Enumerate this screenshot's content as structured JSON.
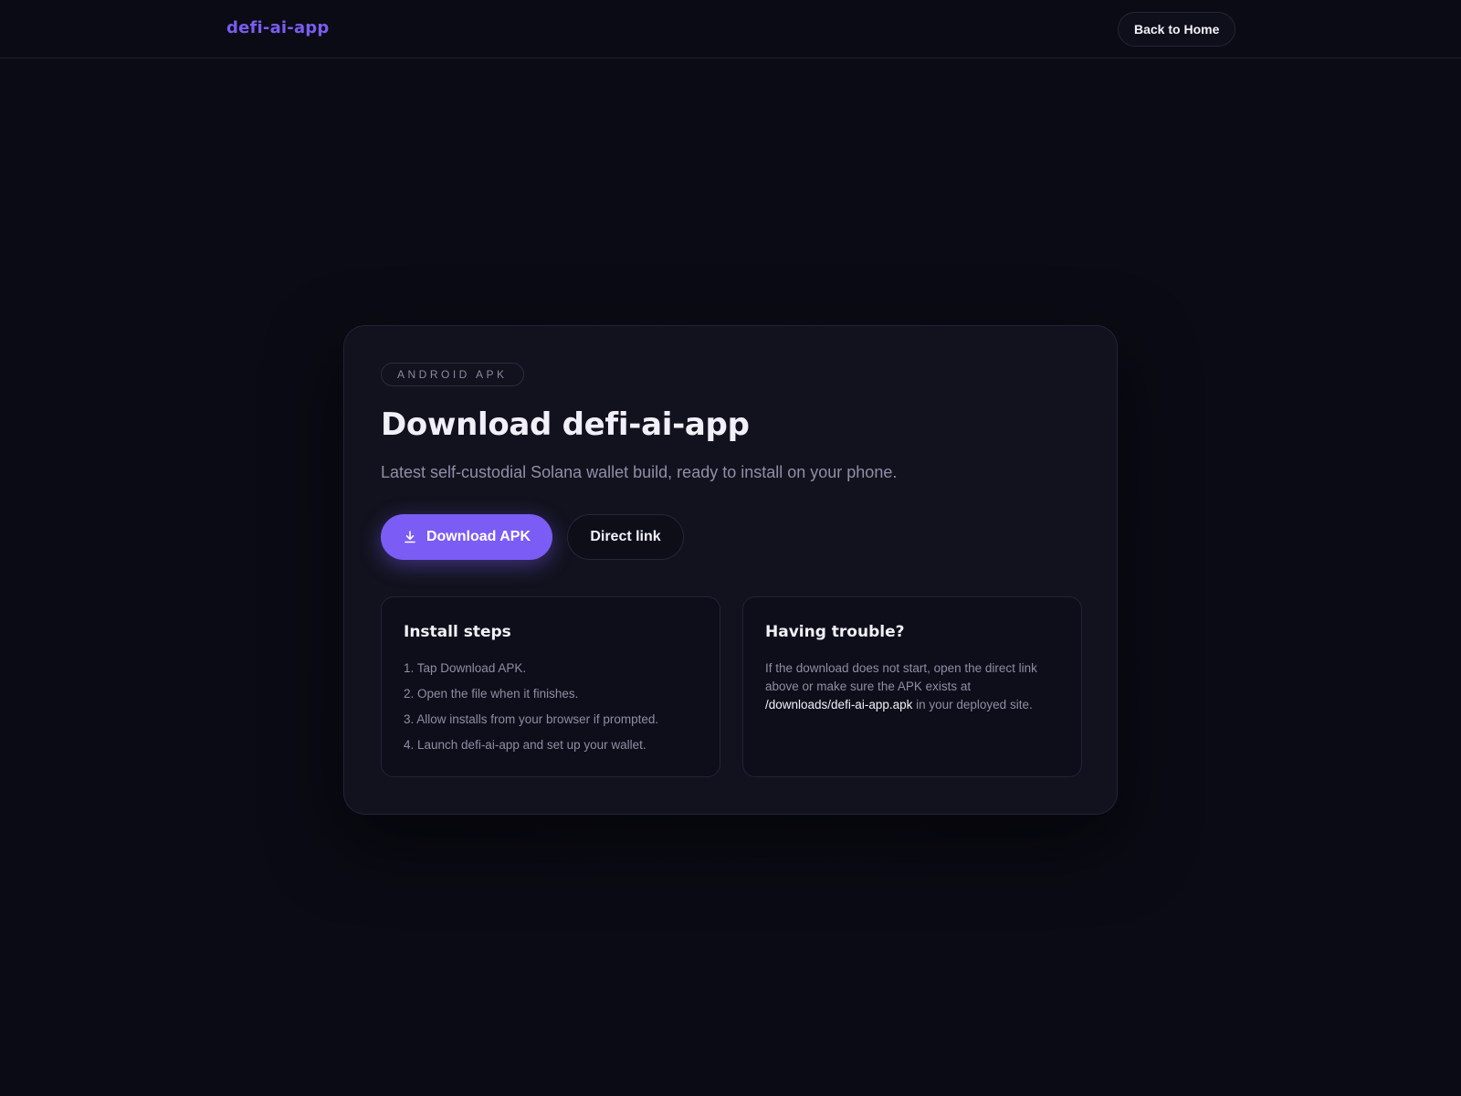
{
  "header": {
    "brand": "defi-ai-app",
    "back_label": "Back to Home"
  },
  "card": {
    "tag": "ANDROID APK",
    "title": "Download defi-ai-app",
    "subtitle": "Latest self-custodial Solana wallet build, ready to install on your phone.",
    "primary_button": {
      "icon": "download-icon",
      "label": "Download APK"
    },
    "secondary_button": {
      "label": "Direct link"
    }
  },
  "install": {
    "heading": "Install steps",
    "steps": [
      "1. Tap Download APK.",
      "2. Open the file when it finishes.",
      "3. Allow installs from your browser if prompted.",
      "4. Launch defi-ai-app and set up your wallet."
    ]
  },
  "trouble": {
    "heading": "Having trouble?",
    "text_before": "If the download does not start, open the direct link above or make sure the APK exists at",
    "path": "/downloads/defi-ai-app.apk",
    "text_after": "in your deployed site."
  },
  "colors": {
    "background": "#0a0b14",
    "accent": "#7b5cf5",
    "brand": "#7c5cf0",
    "card": "#11121d"
  }
}
